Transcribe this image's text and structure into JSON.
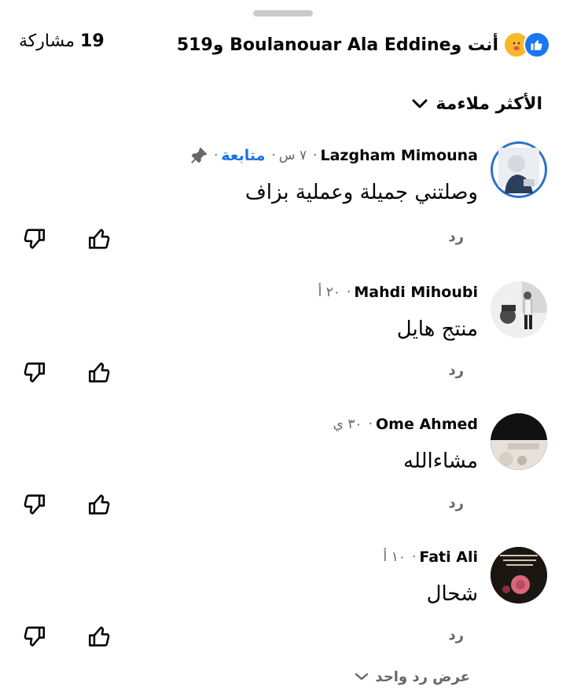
{
  "header": {
    "shares_count": "19",
    "shares_label": "مشاركة",
    "reactions_text": "أنت وBoulanouar Ala Eddine و519",
    "reaction_icons": [
      "like-icon",
      "care-icon"
    ]
  },
  "sort": {
    "label": "الأكثر ملاءمة"
  },
  "comments": [
    {
      "name": "Lazgham Mimouna",
      "time": "٧ س",
      "follow": "متابعة",
      "text": "وصلتني جميلة وعملية بزاف",
      "reply": "رد",
      "pinned": true
    },
    {
      "name": "Mahdi Mihoubi",
      "time": "٢٠ أ",
      "text": "منتج هايل",
      "reply": "رد"
    },
    {
      "name": "Ome Ahmed",
      "time": "٣٠ ي",
      "text": "مشاءالله",
      "reply": "رد"
    },
    {
      "name": "Fati Ali",
      "time": "١٠ أ",
      "text": "شحال",
      "reply": "رد"
    }
  ],
  "view_more": {
    "label": "عرض رد واحد"
  },
  "colors": {
    "accent": "#1b74e4",
    "secondary_text": "#65676b",
    "like": "#1877f2",
    "care": "#f7b928"
  }
}
